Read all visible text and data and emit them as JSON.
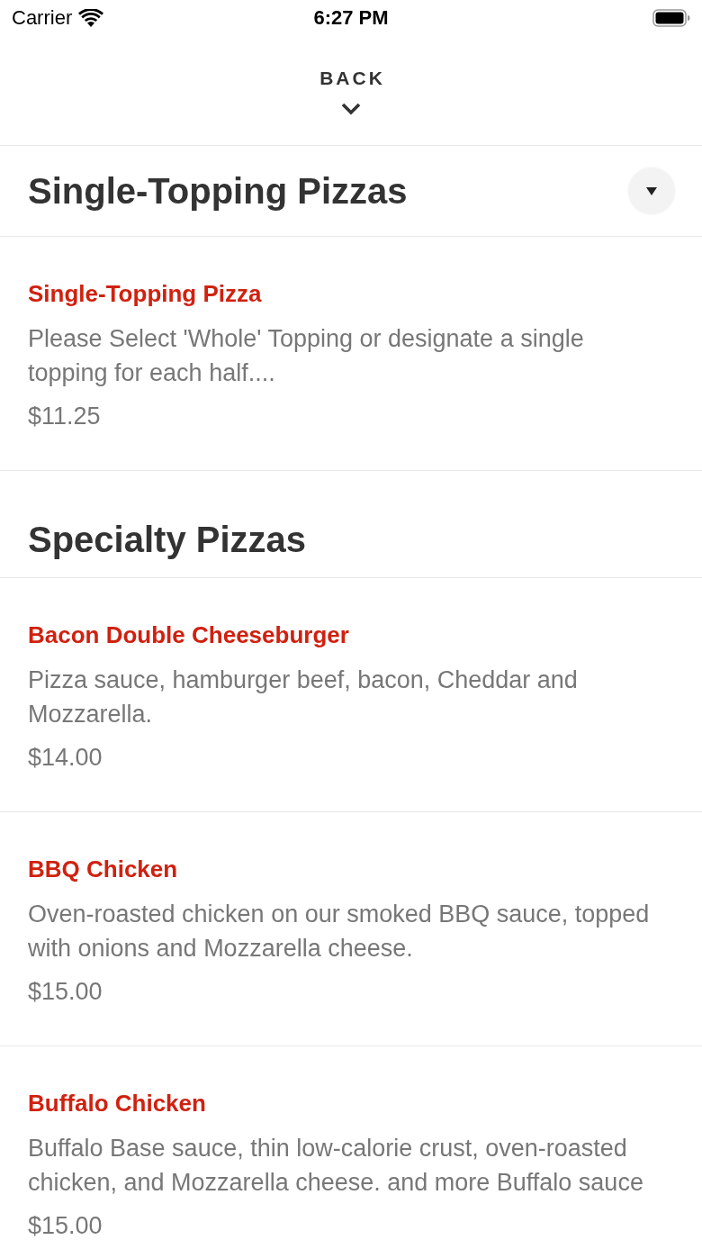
{
  "status_bar": {
    "carrier": "Carrier",
    "time": "6:27 PM"
  },
  "back_button": {
    "label": "BACK"
  },
  "sections": [
    {
      "title": "Single-Topping Pizzas",
      "kind": "sticky",
      "items": [
        {
          "name": "Single-Topping Pizza",
          "description": "Please Select 'Whole' Topping or designate a single topping for each half....",
          "price": "$11.25"
        }
      ]
    },
    {
      "title": "Specialty Pizzas",
      "kind": "plain",
      "items": [
        {
          "name": "Bacon Double Cheeseburger",
          "description": "Pizza sauce, hamburger beef, bacon, Cheddar and Mozzarella.",
          "price": "$14.00"
        },
        {
          "name": "BBQ Chicken",
          "description": "Oven-roasted chicken on our smoked BBQ sauce, topped with onions and Mozzarella cheese.",
          "price": "$15.00"
        },
        {
          "name": "Buffalo Chicken",
          "description": "Buffalo Base sauce, thin low-calorie crust, oven-roasted chicken, and Mozzarella cheese. and more Buffalo sauce",
          "price": "$15.00"
        }
      ]
    }
  ]
}
